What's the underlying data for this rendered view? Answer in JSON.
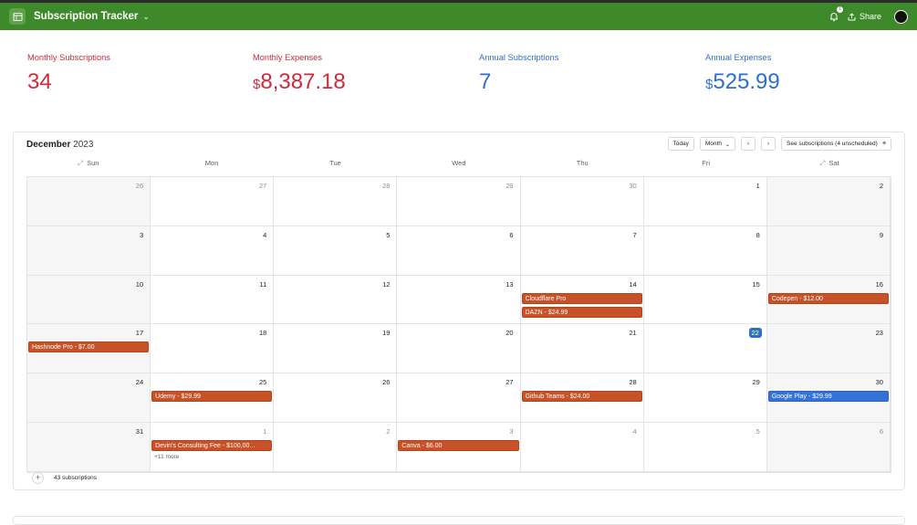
{
  "app": {
    "title": "Subscription Tracker",
    "share_label": "Share",
    "notification_count": "1"
  },
  "stats": [
    {
      "label": "Monthly Subscriptions",
      "currency": "",
      "value": "34",
      "color": "#cf2a3c"
    },
    {
      "label": "Monthly Expenses",
      "currency": "$",
      "value": "8,387.18",
      "color": "#cf2a3c"
    },
    {
      "label": "Annual Subscriptions",
      "currency": "",
      "value": "7",
      "color": "#2d6fd1"
    },
    {
      "label": "Annual Expenses",
      "currency": "$",
      "value": "525.99",
      "color": "#2d6fd1"
    }
  ],
  "calendar": {
    "month": "December",
    "year": "2023",
    "today_label": "Today",
    "view_label": "Month",
    "see_subs_label": "See subscriptions (4 unscheduled)",
    "days_of_week": [
      "Sun",
      "Mon",
      "Tue",
      "Wed",
      "Thu",
      "Fri",
      "Sat"
    ],
    "weeks": [
      [
        "26",
        "27",
        "28",
        "29",
        "30",
        "1",
        "2"
      ],
      [
        "3",
        "4",
        "5",
        "6",
        "7",
        "8",
        "9"
      ],
      [
        "10",
        "11",
        "12",
        "13",
        "14",
        "15",
        "16"
      ],
      [
        "17",
        "18",
        "19",
        "20",
        "21",
        "22",
        "23"
      ],
      [
        "24",
        "25",
        "26",
        "27",
        "28",
        "29",
        "30"
      ],
      [
        "31",
        "1",
        "2",
        "3",
        "4",
        "5",
        "6"
      ]
    ],
    "today": "22",
    "events": {
      "w2d4": [
        "Cloudflare Pro",
        "DAZN - $24.99"
      ],
      "w2d6": [
        "Codepen - $12.00"
      ],
      "w3d0": [
        "Hashnode Pro - $7.00"
      ],
      "w4d1": [
        "Udemy - $29.99"
      ],
      "w4d4": [
        "Github Teams - $24.00"
      ],
      "w4d6": [
        "Google Play - $29.99"
      ],
      "w5d1": [
        "Devin's Consulting Fee - $100,00..."
      ],
      "w5d3": [
        "Canva - $6.00"
      ]
    },
    "blue_events": [
      "w4d6"
    ],
    "more": {
      "w5d1": "+11 more"
    },
    "total_label": "43 subscriptions"
  }
}
